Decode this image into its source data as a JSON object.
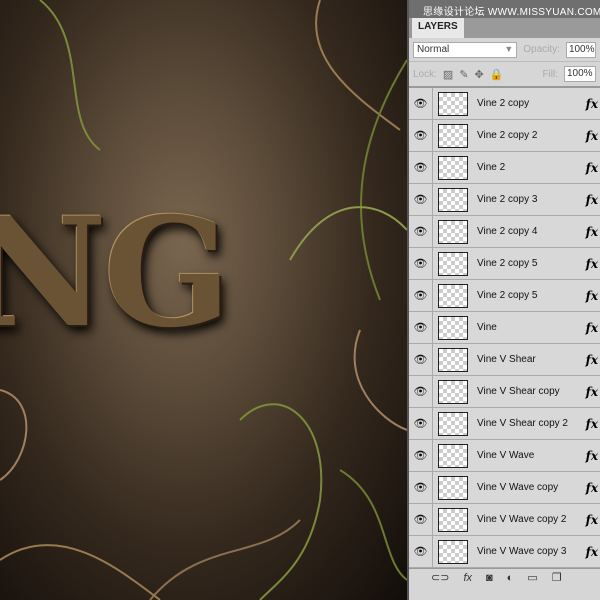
{
  "watermark": "思缘设计论坛 WWW.MISSYUAN.COM",
  "canvas": {
    "text": "NG"
  },
  "panel": {
    "tab": "LAYERS",
    "blend_mode": "Normal",
    "opacity_label": "Opacity:",
    "opacity": "100%",
    "lock_label": "Lock:",
    "fill_label": "Fill:",
    "fill": "100%"
  },
  "layers": [
    {
      "name": "Vine 2 copy"
    },
    {
      "name": "Vine 2 copy 2"
    },
    {
      "name": "Vine 2"
    },
    {
      "name": "Vine 2 copy 3"
    },
    {
      "name": "Vine 2 copy 4"
    },
    {
      "name": "Vine 2 copy 5"
    },
    {
      "name": "Vine 2 copy 5"
    },
    {
      "name": "Vine"
    },
    {
      "name": "Vine V Shear"
    },
    {
      "name": "Vine V Shear copy"
    },
    {
      "name": "Vine V Shear copy 2"
    },
    {
      "name": "Vine V Wave"
    },
    {
      "name": "Vine V Wave copy"
    },
    {
      "name": "Vine V Wave copy 2"
    },
    {
      "name": "Vine V Wave copy 3"
    }
  ],
  "fx_label": "fx"
}
